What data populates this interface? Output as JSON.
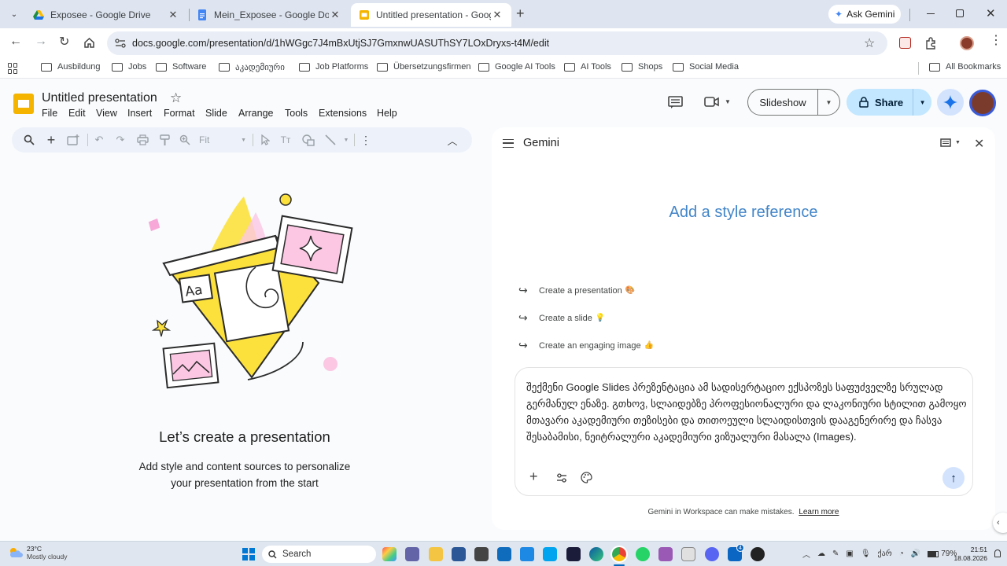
{
  "browser": {
    "tabs": [
      {
        "title": "Exposee - Google Drive",
        "active": false
      },
      {
        "title": "Mein_Exposee - Google Docs",
        "active": false
      },
      {
        "title": "Untitled presentation - Google",
        "active": true
      }
    ],
    "new_tab": "+",
    "ask_gemini": "Ask Gemini",
    "url": "docs.google.com/presentation/d/1hWGgc7J4mBxUtjSJ7GmxnwUASUThSY7LOxDryxs-t4M/edit",
    "bookmarks": [
      "Ausbildung",
      "Jobs",
      "Software",
      "აკადემიური",
      "Job Platforms",
      "Übersetzungsfirmen",
      "Google AI Tools",
      "AI Tools",
      "Shops",
      "Social Media"
    ],
    "all_bookmarks": "All Bookmarks"
  },
  "slides": {
    "doc_title": "Untitled presentation",
    "menu": [
      "File",
      "Edit",
      "View",
      "Insert",
      "Format",
      "Slide",
      "Arrange",
      "Tools",
      "Extensions",
      "Help"
    ],
    "slideshow": "Slideshow",
    "share": "Share",
    "zoom": "Fit",
    "empty_title": "Let’s create a presentation",
    "empty_sub_1": "Add style and content sources to personalize",
    "empty_sub_2": "your presentation from the start",
    "illustration_label": "Aa"
  },
  "gemini": {
    "title": "Gemini",
    "headline": "Add a style reference",
    "suggestions": [
      {
        "label": "Create a presentation",
        "emoji": "🎨"
      },
      {
        "label": "Create a slide",
        "emoji": "💡"
      },
      {
        "label": "Create an engaging image",
        "emoji": "👍"
      }
    ],
    "prompt": "შექმენი Google Slides პრეზენტაცია ამ სადისერტაციო ექსპოზეს საფუძველზე სრულად გერმანულ ენაზე. გთხოვ, სლაიდებზე პროფესიონალური და ლაკონიური სტილით გამოყო მთავარი აკადემიური თეზისები და თითოეული სლაიდისთვის დააგენერირე და ჩასვა შესაბამისი, ნეიტრალური აკადემიური ვიზუალური მასალა (Images).",
    "disclaimer": "Gemini in Workspace can make mistakes.",
    "learn_more": "Learn more"
  },
  "taskbar": {
    "weather_temp": "23°C",
    "weather_desc": "Mostly cloudy",
    "search": "Search",
    "lang": "ქარ",
    "battery": "79%",
    "time": "21:51",
    "date": "18.08.2026",
    "badge": "4"
  },
  "colors": {
    "accent_blue": "#0b57d0",
    "share_bg": "#c2e7ff",
    "gemini_headline": "#4285c8",
    "slides_yellow": "#f4b400"
  }
}
